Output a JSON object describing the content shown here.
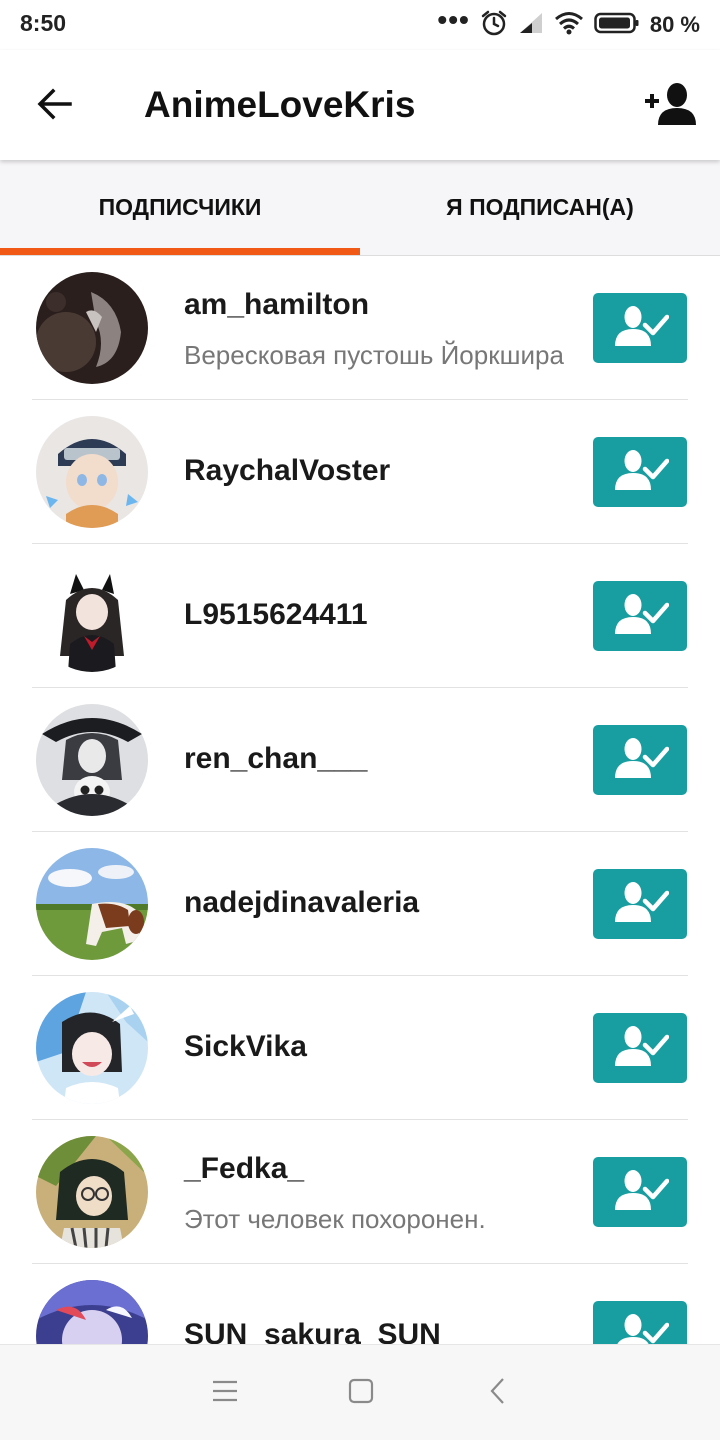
{
  "status_bar": {
    "time": "8:50",
    "dots": "•••",
    "battery_percent": "80 %",
    "icons": [
      "alarm-icon",
      "signal-icon",
      "wifi-icon",
      "battery-icon"
    ]
  },
  "app_bar": {
    "title": "AnimeLoveKris",
    "back_icon": "arrow-left-icon",
    "action_icon": "add-user-icon"
  },
  "tabs": [
    {
      "label": "ПОДПИСЧИКИ",
      "active": true
    },
    {
      "label": "Я ПОДПИСАН(А)",
      "active": false
    }
  ],
  "followers": [
    {
      "username": "am_hamilton",
      "subtitle": "Вересковая пустошь Йоркшира",
      "following": true
    },
    {
      "username": "RaychalVoster",
      "subtitle": "",
      "following": true
    },
    {
      "username": "L9515624411",
      "subtitle": "",
      "following": true
    },
    {
      "username": "ren_chan___",
      "subtitle": "",
      "following": true
    },
    {
      "username": "nadejdinavaleria",
      "subtitle": "",
      "following": true
    },
    {
      "username": "SickVika",
      "subtitle": "",
      "following": true
    },
    {
      "username": "_Fedka_",
      "subtitle": "Этот человек похоронен.",
      "following": true
    },
    {
      "username": "SUN_sakura_SUN",
      "subtitle": "",
      "following": true
    }
  ],
  "colors": {
    "accent_tab_indicator": "#f15a16",
    "follow_button": "#189ea0",
    "tab_background": "#f6f5f7"
  },
  "nav_bar": {
    "icons": [
      "menu-icon",
      "home-square-icon",
      "back-chevron-icon"
    ]
  }
}
